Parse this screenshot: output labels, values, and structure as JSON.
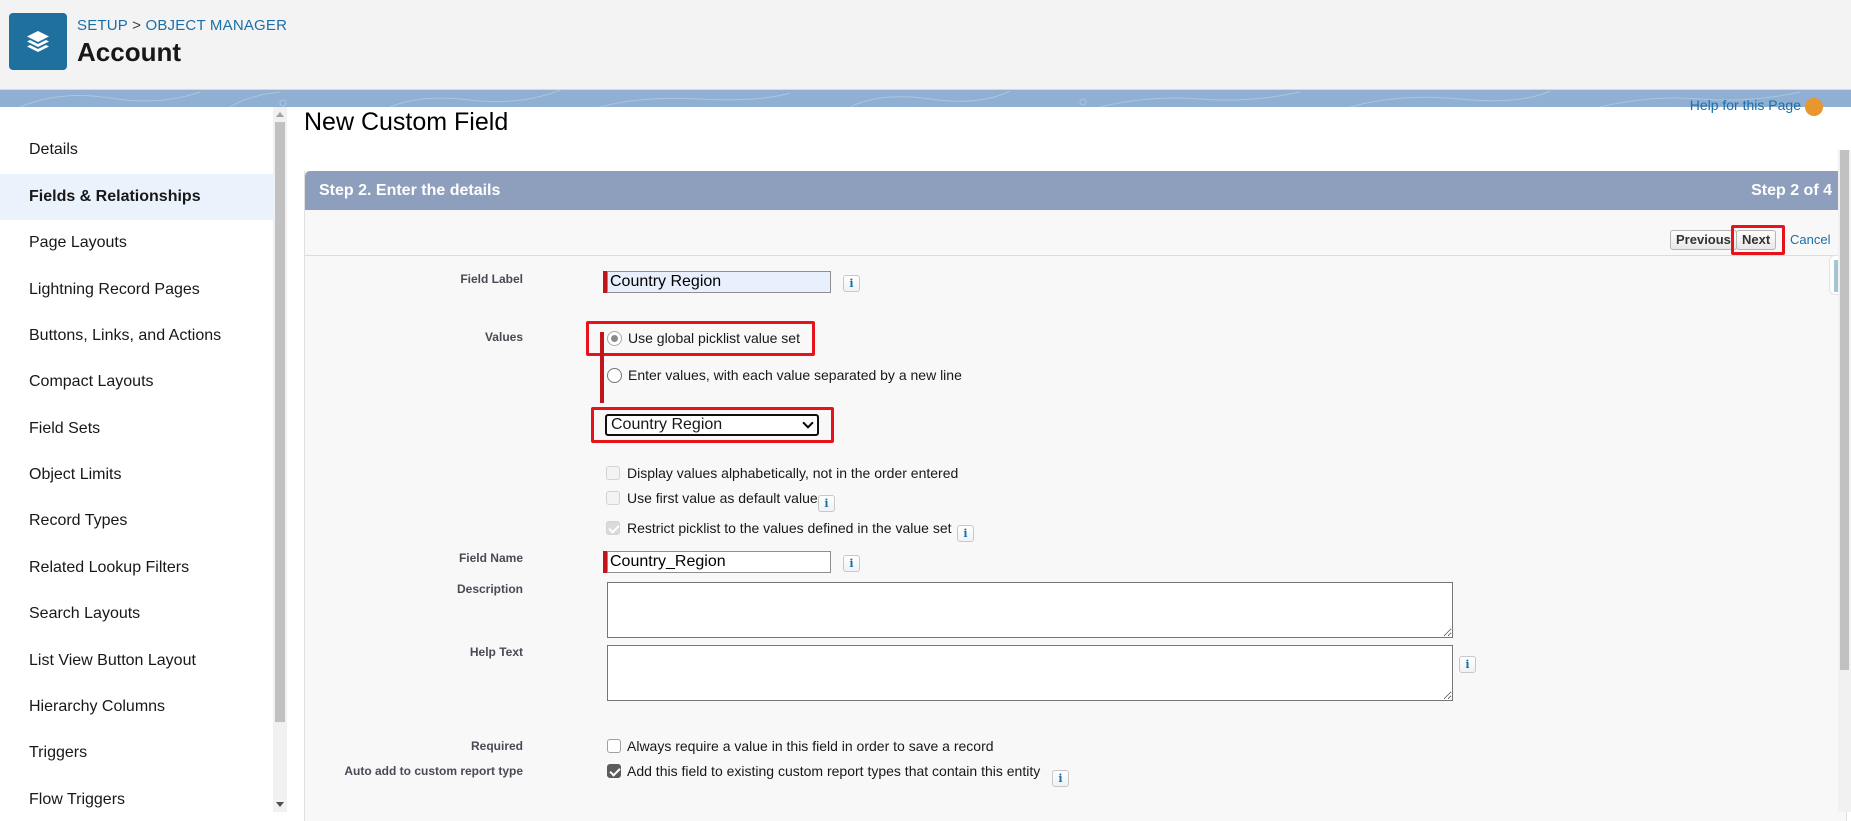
{
  "header": {
    "breadcrumb_setup": "SETUP",
    "breadcrumb_sep": " > ",
    "breadcrumb_object_manager": "OBJECT MANAGER",
    "object_title": "Account",
    "logo_icon": "layers-icon",
    "brand_color": "#1f6f9f"
  },
  "sidebar": {
    "items": [
      {
        "label": "Details"
      },
      {
        "label": "Fields & Relationships",
        "active": true
      },
      {
        "label": "Page Layouts"
      },
      {
        "label": "Lightning Record Pages"
      },
      {
        "label": "Buttons, Links, and Actions"
      },
      {
        "label": "Compact Layouts"
      },
      {
        "label": "Field Sets"
      },
      {
        "label": "Object Limits"
      },
      {
        "label": "Record Types"
      },
      {
        "label": "Related Lookup Filters"
      },
      {
        "label": "Search Layouts"
      },
      {
        "label": "List View Button Layout"
      },
      {
        "label": "Hierarchy Columns"
      },
      {
        "label": "Triggers"
      },
      {
        "label": "Flow Triggers"
      }
    ]
  },
  "main": {
    "page_title": "New Custom Field",
    "help_link": "Help for this Page",
    "step_title": "Step 2. Enter the details",
    "step_counter": "Step 2 of 4",
    "buttons": {
      "previous": "Previous",
      "next": "Next",
      "cancel": "Cancel"
    },
    "form": {
      "field_label": {
        "label": "Field Label",
        "value": "Country Region"
      },
      "values": {
        "label": "Values",
        "option_global": "Use global picklist value set",
        "option_global_selected": true,
        "option_enter": "Enter values, with each value separated by a new line",
        "option_enter_selected": false,
        "global_set_selected": "Country Region"
      },
      "checkboxes": {
        "alphabetical": {
          "label": "Display values alphabetically, not in the order entered",
          "checked": false,
          "disabled": true
        },
        "first_default": {
          "label": "Use first value as default value",
          "checked": false,
          "disabled": true
        },
        "restrict": {
          "label": "Restrict picklist to the values defined in the value set",
          "checked": true,
          "disabled": true
        }
      },
      "field_name": {
        "label": "Field Name",
        "value": "Country_Region"
      },
      "description": {
        "label": "Description",
        "value": ""
      },
      "help_text": {
        "label": "Help Text",
        "value": ""
      },
      "required": {
        "label": "Required",
        "text": "Always require a value in this field in order to save a record",
        "checked": false
      },
      "auto_add": {
        "label": "Auto add to custom report type",
        "text": "Add this field to existing custom report types that contain this entity",
        "checked": true
      }
    },
    "info_icon_glyph": "i"
  },
  "highlight_color": "#e8121b"
}
